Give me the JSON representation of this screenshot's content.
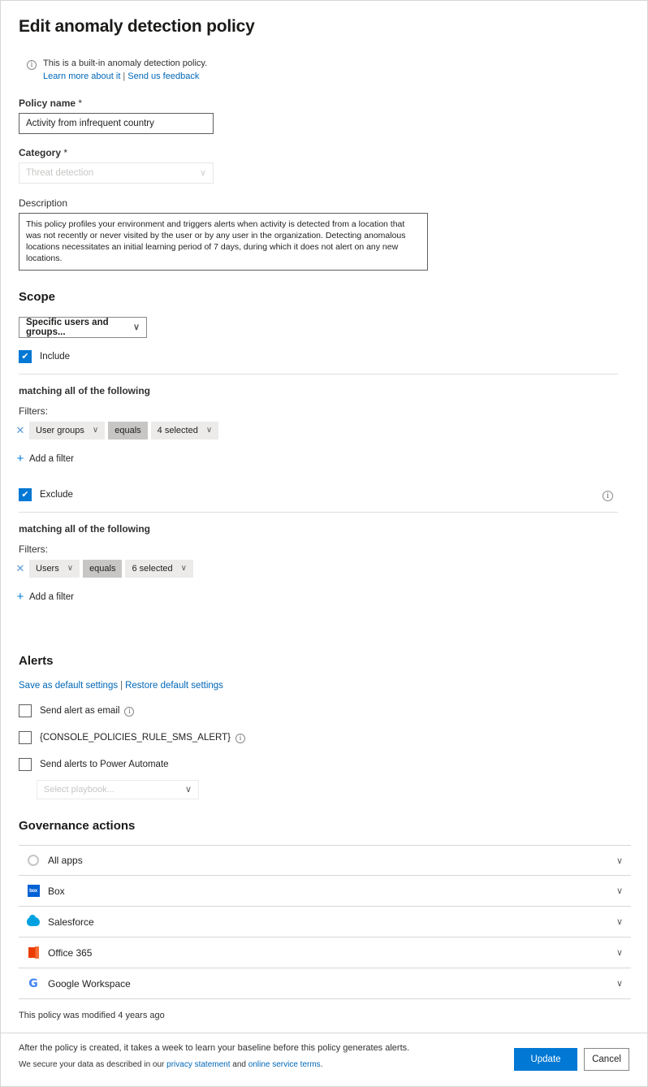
{
  "page": {
    "title": "Edit anomaly detection policy"
  },
  "banner": {
    "icon": "info-icon",
    "text": "This is a built-in anomaly detection policy.",
    "link_learn": "Learn more about it",
    "separator": "|",
    "link_feedback": "Send us feedback"
  },
  "policy_name": {
    "label": "Policy name",
    "required_mark": "*",
    "value": "Activity from infrequent country"
  },
  "category": {
    "label": "Category",
    "required_mark": "*",
    "value": "Threat detection",
    "chevron": "∨"
  },
  "description": {
    "label": "Description",
    "value": "This policy profiles your environment and triggers alerts when activity is detected from a location that was not recently or never visited by the user or by any user in the organization. Detecting anomalous locations necessitates an initial learning period of 7 days, during which it does not alert on any new locations."
  },
  "scope": {
    "heading": "Scope",
    "dropdown_value": "Specific users and groups...",
    "chevron": "∨",
    "include": {
      "label": "Include",
      "checked": true,
      "check_glyph": "✔",
      "matching_text": "matching all of the following",
      "filters_label": "Filters:",
      "remove_glyph": "✕",
      "filter": {
        "field": "User groups",
        "operator": "equals",
        "value": "4 selected",
        "chevron": "∨"
      },
      "add_filter": "Add a filter",
      "add_glyph": "+"
    },
    "exclude": {
      "label": "Exclude",
      "checked": true,
      "check_glyph": "✔",
      "info_icon": "info-icon",
      "matching_text": "matching all of the following",
      "filters_label": "Filters:",
      "remove_glyph": "✕",
      "filter": {
        "field": "Users",
        "operator": "equals",
        "value": "6 selected",
        "chevron": "∨"
      },
      "add_filter": "Add a filter",
      "add_glyph": "+"
    }
  },
  "alerts": {
    "heading": "Alerts",
    "save_default": "Save as default settings",
    "separator": "|",
    "restore_default": "Restore default settings",
    "options": [
      {
        "label": "Send alert as email",
        "checked": false,
        "has_info": true
      },
      {
        "label": "{CONSOLE_POLICIES_RULE_SMS_ALERT}",
        "checked": false,
        "has_info": true
      },
      {
        "label": "Send alerts to Power Automate",
        "checked": false,
        "has_info": false
      }
    ],
    "playbook_placeholder": "Select playbook...",
    "playbook_chevron": "∨"
  },
  "governance": {
    "heading": "Governance actions",
    "rows": [
      {
        "label": "All apps",
        "icon": "all-apps-icon",
        "chevron": "∨"
      },
      {
        "label": "Box",
        "icon": "box-icon",
        "icon_text": "box",
        "chevron": "∨"
      },
      {
        "label": "Salesforce",
        "icon": "salesforce-icon",
        "chevron": "∨"
      },
      {
        "label": "Office 365",
        "icon": "office365-icon",
        "chevron": "∨"
      },
      {
        "label": "Google Workspace",
        "icon": "google-workspace-icon",
        "icon_text": "G",
        "chevron": "∨"
      }
    ]
  },
  "footer": {
    "modified_text": "This policy was modified 4 years ago",
    "baseline_text": "After the policy is created, it takes a week to learn your baseline before this policy generates alerts.",
    "secure_prefix": "We secure your data as described in our ",
    "privacy_link": "privacy statement",
    "and_text": " and ",
    "terms_link": "online service terms",
    "period": ".",
    "update_button": "Update",
    "cancel_button": "Cancel"
  },
  "colors": {
    "accent": "#0078d4",
    "link": "#0067b8",
    "chip": "#edebe9",
    "chip_dark": "#c8c6c4",
    "border": "#d6d6d6"
  }
}
